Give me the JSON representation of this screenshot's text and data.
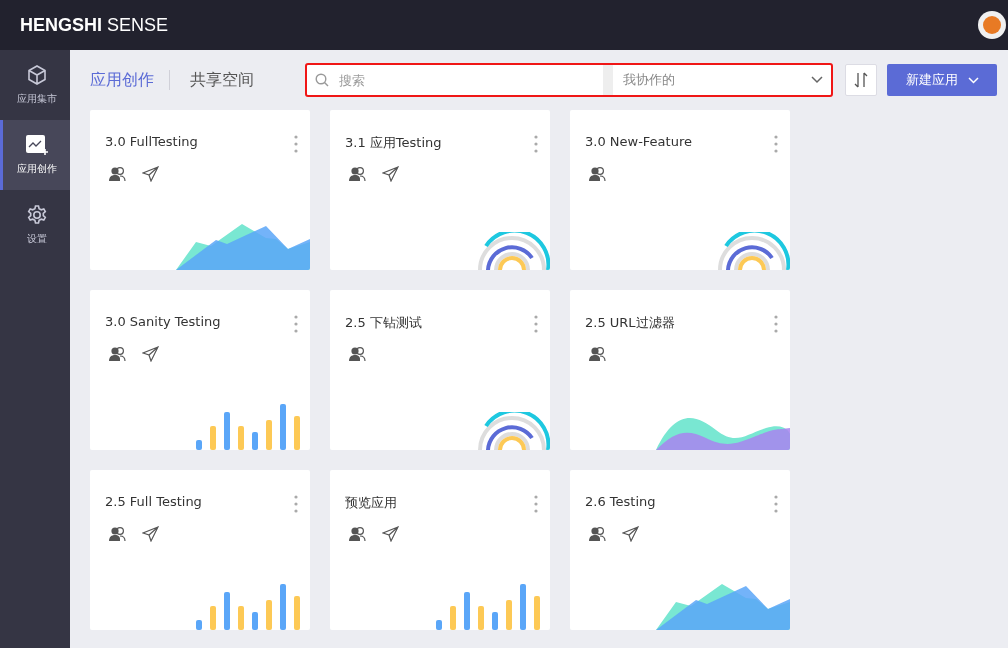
{
  "header": {
    "brand_bold": "HENGSHI",
    "brand_light": "SENSE"
  },
  "sidebar": {
    "items": [
      {
        "label": "应用集市",
        "kind": "cube",
        "selected": false
      },
      {
        "label": "应用创作",
        "kind": "chart",
        "selected": true
      },
      {
        "label": "设置",
        "kind": "gear",
        "selected": false
      }
    ]
  },
  "tabs": [
    {
      "label": "应用创作",
      "selected": true
    },
    {
      "label": "共享空间",
      "selected": false
    }
  ],
  "search": {
    "placeholder": "搜索"
  },
  "filter": {
    "value": "我协作的"
  },
  "new_button": {
    "label": "新建应用"
  },
  "apps": [
    {
      "title": "3.0 FullTesting",
      "published": true,
      "kind": "mountain"
    },
    {
      "title": "3.1 应用Testing",
      "published": true,
      "kind": "rings"
    },
    {
      "title": "3.0 New-Feature",
      "published": false,
      "kind": "rings"
    },
    {
      "title": "3.0 Sanity Testing",
      "published": true,
      "kind": "bars"
    },
    {
      "title": "2.5 下钻测试",
      "published": false,
      "kind": "rings"
    },
    {
      "title": "2.5 URL过滤器",
      "published": false,
      "kind": "waves"
    },
    {
      "title": "2.5 Full Testing",
      "published": true,
      "kind": "bars"
    },
    {
      "title": "预览应用",
      "published": true,
      "kind": "bars"
    },
    {
      "title": "2.6 Testing",
      "published": true,
      "kind": "mountain"
    }
  ]
}
